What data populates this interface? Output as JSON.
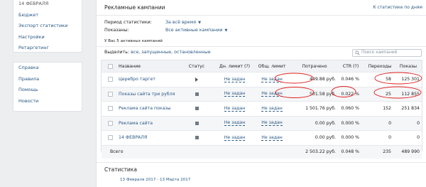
{
  "sidebar": {
    "group1": [
      {
        "label": "14 ФЕВРАЛЯ",
        "muted": true
      },
      {
        "label": "Бюджет"
      },
      {
        "label": "Экспорт статистики"
      },
      {
        "label": "Настройки"
      },
      {
        "label": "Ретаргетинг"
      }
    ],
    "group2": [
      {
        "label": "Справка"
      },
      {
        "label": "Правила"
      },
      {
        "label": "Помощь"
      },
      {
        "label": "Новости"
      }
    ]
  },
  "panel": {
    "title": "Рекламные кампании",
    "stats_by_day_link": "К статистике по дням",
    "filters": {
      "period_label": "Период статистики:",
      "period_value": "За всё время",
      "shown_label": "Показаны:",
      "shown_value": "Все активные кампании"
    },
    "active_note": "У Вас 5 активных кампаний",
    "select_label": "Выделить:",
    "select_link": "все, запущенные, остановленные",
    "search_placeholder": "Поиск кампаний"
  },
  "table": {
    "columns": [
      "Название",
      "Статус",
      "Дн. лимит (?)",
      "Общ. лимит",
      "Потрачено",
      "CTR (?)",
      "Переходы",
      "Показы"
    ],
    "rows": [
      {
        "name": "Церебро таргет",
        "status": "play-icon",
        "day_limit": "Не задан",
        "total_limit": "Не задан",
        "spent": "499.88 руб.",
        "ctr": "0.046 %",
        "clicks": "58",
        "views": "125 301"
      },
      {
        "name": "Показы сайта три рубля",
        "status": "stop-icon",
        "day_limit": "Не задан",
        "total_limit": "Не задан",
        "spent": "501.58 руб.",
        "ctr": "0.022 %",
        "clicks": "25",
        "views": "112 855"
      },
      {
        "name": "Реклама сайта показы",
        "status": "stop-icon",
        "day_limit": "Не задан",
        "total_limit": "Не задан",
        "spent": "1 501.76 руб.",
        "ctr": "0.060 %",
        "clicks": "152",
        "views": "251 834"
      },
      {
        "name": "Реклама сайта",
        "status": "stop-icon",
        "day_limit": "Не задан",
        "total_limit": "Не задан",
        "spent": "0.00 руб.",
        "ctr": "0.000 %",
        "clicks": "0",
        "views": "0"
      },
      {
        "name": "14 ФЕВРАЛЯ",
        "status": "stop-icon",
        "day_limit": "Не задан",
        "total_limit": "Не задан",
        "spent": "0.00 руб.",
        "ctr": "0.000 %",
        "clicks": "0",
        "views": "0"
      }
    ],
    "total": {
      "label": "Всего",
      "spent": "2 503.22 руб.",
      "ctr": "0.048 %",
      "clicks": "235",
      "views": "489 990"
    }
  },
  "stats": {
    "title": "Статистика",
    "range": "13 Февраля 2017 - 13 Марта 2017"
  },
  "colors": {
    "link": "#2a5885",
    "annotation": "#e02020"
  }
}
